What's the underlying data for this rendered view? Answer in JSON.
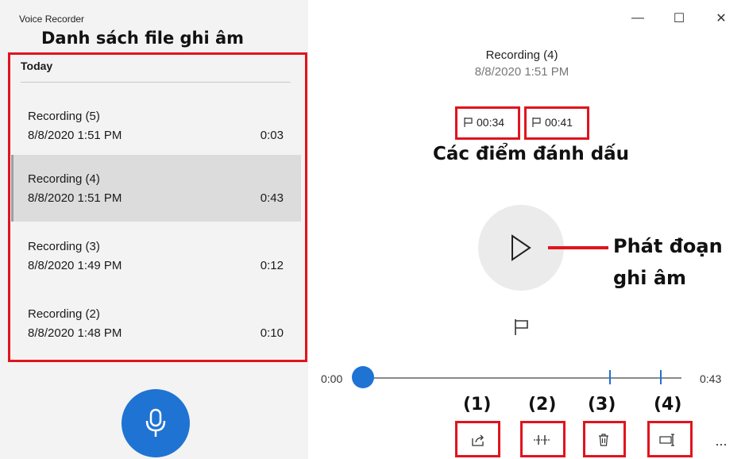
{
  "window": {
    "title": "Voice Recorder",
    "minimize": "—",
    "maximize": "☐",
    "close": "✕"
  },
  "annotations": {
    "list_title": "Danh sách file ghi âm",
    "markers_title": "Các điểm đánh dấu",
    "play_line1": "Phát đoạn",
    "play_line2": "ghi âm",
    "tool_numbers": [
      "(1)",
      "(2)",
      "(3)",
      "(4)"
    ]
  },
  "sidebar": {
    "group_header": "Today",
    "recordings": [
      {
        "name": "Recording (5)",
        "date": "8/8/2020 1:51 PM",
        "duration": "0:03"
      },
      {
        "name": "Recording (4)",
        "date": "8/8/2020 1:51 PM",
        "duration": "0:43"
      },
      {
        "name": "Recording (3)",
        "date": "8/8/2020 1:49 PM",
        "duration": "0:12"
      },
      {
        "name": "Recording (2)",
        "date": "8/8/2020 1:48 PM",
        "duration": "0:10"
      }
    ],
    "selected_index": 1
  },
  "player": {
    "title": "Recording (4)",
    "date": "8/8/2020 1:51 PM",
    "markers": [
      "00:34",
      "00:41"
    ],
    "time_start": "0:00",
    "time_end": "0:43",
    "progress_seconds": 0,
    "total_seconds": 43
  },
  "toolbar": {
    "share_icon": "share-icon",
    "trim_icon": "trim-icon",
    "delete_icon": "trash-icon",
    "rename_icon": "rename-icon",
    "more": "..."
  },
  "colors": {
    "accent": "#1f73d2",
    "annotation_red": "#e0141e",
    "sidebar_bg": "#f3f3f3",
    "selected_bg": "#dcdcdc"
  }
}
